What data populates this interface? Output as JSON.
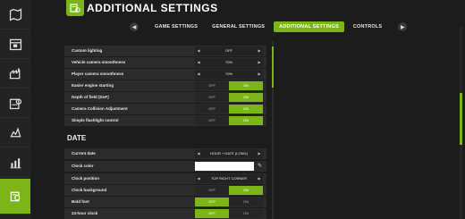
{
  "header": {
    "title": "ADDITIONAL SETTINGS"
  },
  "tabs": [
    {
      "label": "GAME SETTINGS",
      "active": false
    },
    {
      "label": "GENERAL SETTINGS",
      "active": false
    },
    {
      "label": "ADDITIONAL SETTINGS",
      "active": true
    },
    {
      "label": "CONTROLS",
      "active": false
    }
  ],
  "sidebar": {
    "icons": [
      "map-icon",
      "calendar-icon",
      "production-icon",
      "finance-icon",
      "animals-icon",
      "statistics-icon",
      "settings-icon"
    ],
    "active_index": 6
  },
  "camera": {
    "custom_lighting": {
      "label": "Custom lighting",
      "value": "OFF"
    },
    "vehicle_camera_smoothness": {
      "label": "Vehicle camera smoothness",
      "value": "70%"
    },
    "player_camera_smoothness": {
      "label": "Player camera smoothness",
      "value": "70%"
    },
    "easier_engine_starting": {
      "label": "Easier engine starting",
      "off": "OFF",
      "on": "ON",
      "state": "on"
    },
    "depth_of_field": {
      "label": "Depth of field (DoF)",
      "off": "OFF",
      "on": "ON",
      "state": "on"
    },
    "camera_collision": {
      "label": "Camera Collision Adjustment",
      "off": "OFF",
      "on": "ON",
      "state": "on"
    },
    "flashlight_control": {
      "label": "Simple flashlight control",
      "off": "OFF",
      "on": "ON",
      "state": "on"
    }
  },
  "date": {
    "section_title": "DATE",
    "current_date": {
      "label": "Current date",
      "value": "HOUR + DATE (LONG)"
    },
    "clock_color": {
      "label": "Clock color",
      "color": "#ffffff"
    },
    "clock_position": {
      "label": "Clock position",
      "value": "TOP RIGHT CORNER"
    },
    "clock_background": {
      "label": "Clock background",
      "off": "OFF",
      "on": "ON",
      "state": "on"
    },
    "bold_font": {
      "label": "Bold font",
      "off": "OFF",
      "on": "ON",
      "state": "off"
    },
    "hour_clock_24": {
      "label": "24-hour clock",
      "off": "OFF",
      "on": "ON",
      "state": "off"
    }
  },
  "colors": {
    "accent": "#7cb518",
    "background": "#1c1c1c",
    "row": "#2b2b2b"
  }
}
